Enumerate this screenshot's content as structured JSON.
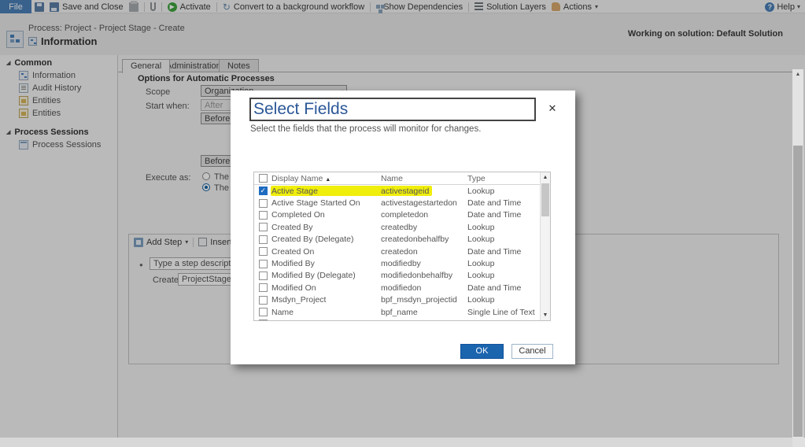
{
  "toolbar": {
    "file_label": "File",
    "save_and_close_label": "Save and Close",
    "activate_label": "Activate",
    "convert_label": "Convert to a background workflow",
    "show_dependencies_label": "Show Dependencies",
    "solution_layers_label": "Solution Layers",
    "actions_label": "Actions",
    "help_label": "Help"
  },
  "header": {
    "process_title": "Process: Project - Project Stage - Create",
    "subtitle": "Information",
    "working_on": "Working on solution: Default Solution"
  },
  "sidebar": {
    "groups": [
      {
        "label": "Common",
        "items": [
          {
            "label": "Information"
          },
          {
            "label": "Audit History"
          },
          {
            "label": "Entities"
          },
          {
            "label": "Entities"
          }
        ]
      },
      {
        "label": "Process Sessions",
        "items": [
          {
            "label": "Process Sessions"
          }
        ]
      }
    ]
  },
  "tabs": {
    "general": "General",
    "administration": "Administration",
    "notes": "Notes"
  },
  "form": {
    "section_title": "Options for Automatic Processes",
    "scope_label": "Scope",
    "scope_value": "Organization",
    "start_when_label": "Start when:",
    "start_when_value": "After",
    "before_value_1": "Before",
    "before_value_2": "Before",
    "execute_as_label": "Execute as:",
    "execute_option_1": "The ow",
    "execute_option_2": "The use",
    "step_toolbar": {
      "add_step_label": "Add Step",
      "insert_label": "Insert"
    },
    "step_description_value": "Type a step description her",
    "create_label": "Create:",
    "create_value": "ProjectStageTrack"
  },
  "modal": {
    "title": "Select Fields",
    "description": "Select the fields that the process will monitor for changes.",
    "table": {
      "columns": {
        "display_name": "Display Name",
        "name": "Name",
        "type": "Type"
      },
      "rows": [
        {
          "checked": true,
          "highlight": true,
          "display_name": "Active Stage",
          "name": "activestageid",
          "type": "Lookup"
        },
        {
          "checked": false,
          "highlight": false,
          "display_name": "Active Stage Started On",
          "name": "activestagestartedon",
          "type": "Date and Time"
        },
        {
          "checked": false,
          "highlight": false,
          "display_name": "Completed On",
          "name": "completedon",
          "type": "Date and Time"
        },
        {
          "checked": false,
          "highlight": false,
          "display_name": "Created By",
          "name": "createdby",
          "type": "Lookup"
        },
        {
          "checked": false,
          "highlight": false,
          "display_name": "Created By (Delegate)",
          "name": "createdonbehalfby",
          "type": "Lookup"
        },
        {
          "checked": false,
          "highlight": false,
          "display_name": "Created On",
          "name": "createdon",
          "type": "Date and Time"
        },
        {
          "checked": false,
          "highlight": false,
          "display_name": "Modified By",
          "name": "modifiedby",
          "type": "Lookup"
        },
        {
          "checked": false,
          "highlight": false,
          "display_name": "Modified By (Delegate)",
          "name": "modifiedonbehalfby",
          "type": "Lookup"
        },
        {
          "checked": false,
          "highlight": false,
          "display_name": "Modified On",
          "name": "modifiedon",
          "type": "Date and Time"
        },
        {
          "checked": false,
          "highlight": false,
          "display_name": "Msdyn_Project",
          "name": "bpf_msdyn_projectid",
          "type": "Lookup"
        },
        {
          "checked": false,
          "highlight": false,
          "display_name": "Name",
          "name": "bpf_name",
          "type": "Single Line of Text"
        }
      ]
    },
    "ok_label": "OK",
    "cancel_label": "Cancel"
  },
  "icons": {
    "chevron_down": "▾",
    "sort_asc": "▲",
    "close": "✕",
    "collapse": "◢",
    "bullet": "●",
    "delete_x": "✕",
    "convert_glyph": "↻",
    "question": "?",
    "scroll_up": "▲",
    "scroll_down": "▼"
  },
  "colors": {
    "accent_blue": "#1b64ae",
    "file_tab_blue": "#4a80b8",
    "highlight_yellow": "#f0ee0b",
    "modal_title_blue": "#2b5797",
    "activate_green": "#3fa33f"
  }
}
